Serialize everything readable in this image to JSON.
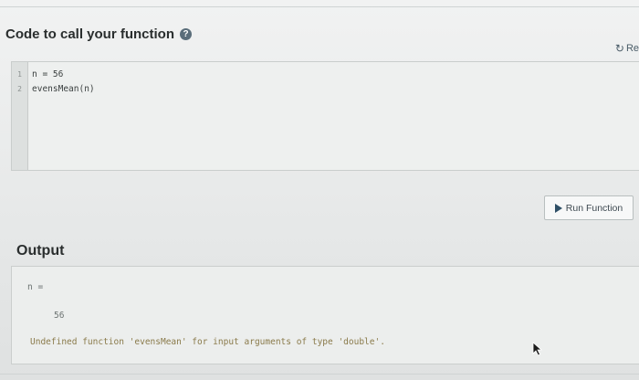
{
  "header": {
    "title": "Code to call your function",
    "help_icon": "?",
    "reset_label": "Re"
  },
  "editor": {
    "lines": [
      {
        "num": "1",
        "code": "n = 56"
      },
      {
        "num": "2",
        "code": "evensMean(n)"
      }
    ]
  },
  "toolbar": {
    "run_label": "Run Function"
  },
  "output": {
    "title": "Output",
    "lines": [
      "n =",
      "56",
      "Undefined function 'evensMean' for input arguments of type 'double'."
    ]
  },
  "colors": {
    "accent": "#2e4f66",
    "help_icon_bg": "#5a6d7a"
  }
}
